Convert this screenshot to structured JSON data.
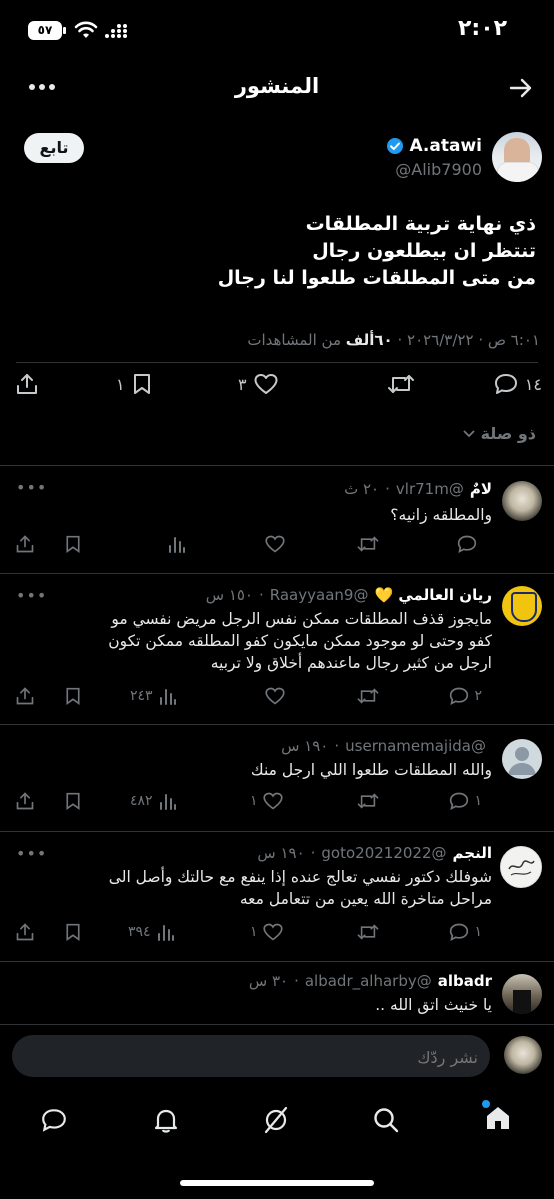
{
  "status_bar": {
    "time": "٢:٠٢",
    "battery": "٥٧"
  },
  "header": {
    "title": "المنشور"
  },
  "post": {
    "author_name": "A.atawi",
    "author_handle": "@Alib7900",
    "follow_label": "تابع",
    "lines": [
      "ذي نهاية تربية المطلقات",
      "تنتظر ان بيطلعون رجال",
      "من متى المطلقات طلعوا لنا رجال"
    ],
    "meta_time": "٦:٠١ ص · ٢٠٢٦/٣/٢٢ · ",
    "meta_views_count": "٦٠ألف",
    "meta_views_label": " من المشاهدات",
    "replies": "١٤",
    "reposts": "",
    "likes": "٣",
    "bookmarks": "١"
  },
  "relevance": {
    "label": "ذو صلة"
  },
  "replies": [
    {
      "name": "لامٌ",
      "handle": "@vlr71m",
      "time": "٢٠ ث",
      "text": [
        "والمطلقه زانيه؟"
      ],
      "reply_count": "",
      "like_count": "",
      "views": ""
    },
    {
      "name": "ريان العالمي 💛",
      "handle": "@Raayyaan9",
      "time": "١٥٠ س",
      "text": [
        "مايجوز قذف المطلقات ممكن نفس الرجل مريض نفسي مو",
        "كفو وحتى لو موجود ممكن مايكون كفو المطلقه ممكن تكون",
        "ارجل من كثير رجال ماعندهم أخلاق ولا تربيه"
      ],
      "reply_count": "٢",
      "like_count": "",
      "views": "٢٤٣"
    },
    {
      "name": "",
      "handle": "@usernamemajida",
      "time": "١٩٠ س",
      "text": [
        "والله المطلقات طلعوا اللي ارجل منك"
      ],
      "reply_count": "١",
      "like_count": "١",
      "views": "٤٨٢"
    },
    {
      "name": "النجم",
      "handle": "@goto20212022",
      "time": "١٩٠ س",
      "text": [
        "شوفلك دكتور نفسي تعالج عنده إذا ينفع مع حالتك وأصل الى",
        "مراحل متاخرة الله يعين من تتعامل معه"
      ],
      "reply_count": "١",
      "like_count": "١",
      "views": "٣٩٤"
    },
    {
      "name": "albadr",
      "handle": "@albadr_alharby",
      "time": "٣٠ س",
      "text": [
        "يا خنيث اتق الله .."
      ],
      "reply_count": "",
      "like_count": "",
      "views": ""
    }
  ],
  "composer": {
    "placeholder": "نشر ردّك"
  },
  "colors": {
    "verified": "#1d9bf0",
    "accent_dot": "#1d9bf0",
    "divider": "#2f3336"
  }
}
